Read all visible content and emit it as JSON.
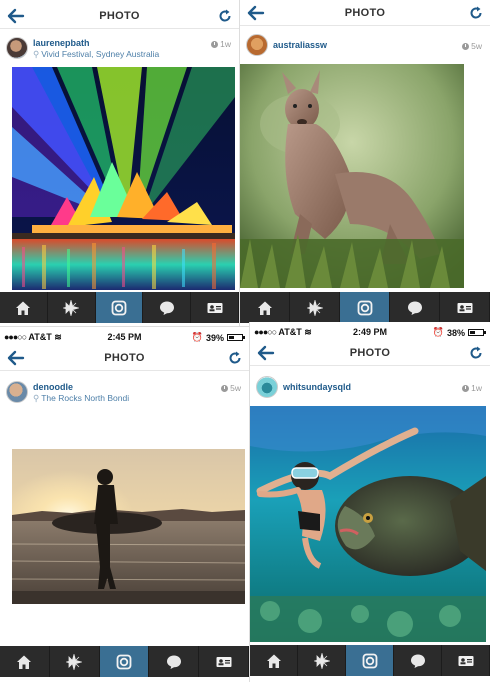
{
  "screen_title": "PHOTO",
  "panels": [
    {
      "username": "laurenepbath",
      "location": "Vivid Festival, Sydney Australia",
      "age": "1w"
    },
    {
      "username": "australiassw",
      "location": "",
      "age": "5w"
    },
    {
      "status": {
        "carrier": "AT&T",
        "time": "2:45 PM",
        "battery": "39%",
        "battery_level": 0.39
      },
      "username": "denoodle",
      "location": "The Rocks North Bondi",
      "age": "5w"
    },
    {
      "status": {
        "carrier": "AT&T",
        "time": "2:49 PM",
        "battery": "38%",
        "battery_level": 0.38
      },
      "username": "whitsundaysqld",
      "location": "",
      "age": "1w"
    }
  ],
  "tabs": [
    "home-icon",
    "explore-icon",
    "camera-icon",
    "activity-icon",
    "profile-icon"
  ],
  "active_tab": 2,
  "colors": {
    "accent": "#1f5a8a",
    "tabbar": "#2b2b2b",
    "tab_active": "#3a6f93"
  }
}
